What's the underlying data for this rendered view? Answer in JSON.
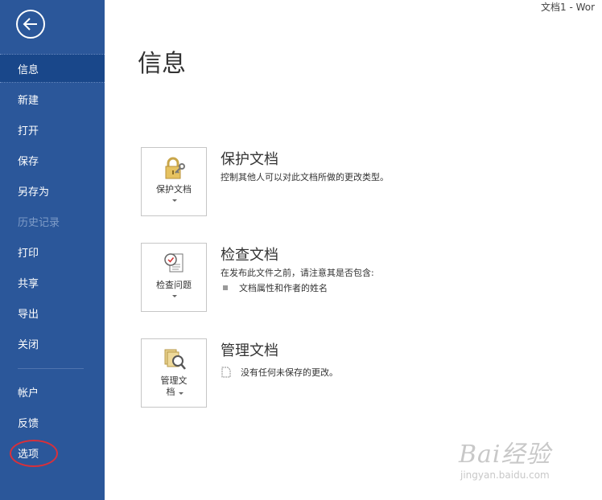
{
  "window": {
    "title": "文档1 - Wor"
  },
  "sidebar": {
    "items": [
      {
        "label": "信息",
        "state": "active"
      },
      {
        "label": "新建",
        "state": "normal"
      },
      {
        "label": "打开",
        "state": "normal"
      },
      {
        "label": "保存",
        "state": "normal"
      },
      {
        "label": "另存为",
        "state": "normal"
      },
      {
        "label": "历史记录",
        "state": "disabled"
      },
      {
        "label": "打印",
        "state": "normal"
      },
      {
        "label": "共享",
        "state": "normal"
      },
      {
        "label": "导出",
        "state": "normal"
      },
      {
        "label": "关闭",
        "state": "normal"
      },
      {
        "label": "帐户",
        "state": "normal"
      },
      {
        "label": "反馈",
        "state": "normal"
      },
      {
        "label": "选项",
        "state": "normal"
      }
    ]
  },
  "main": {
    "title": "信息",
    "sections": {
      "protect": {
        "button_label": "保护文档",
        "title": "保护文档",
        "description": "控制其他人可以对此文档所做的更改类型。"
      },
      "inspect": {
        "button_label": "检查问题",
        "title": "检查文档",
        "description": "在发布此文件之前，请注意其是否包含:",
        "bullets": [
          "文档属性和作者的姓名"
        ]
      },
      "manage": {
        "button_label_line1": "管理文",
        "button_label_line2": "档",
        "title": "管理文档",
        "note": "没有任何未保存的更改。"
      }
    }
  },
  "watermark": {
    "text": "Bai经验",
    "url_text": "jingyan.baidu.com"
  },
  "colors": {
    "sidebar_bg": "#2b579a",
    "active_bg": "#19478a",
    "highlight_circle": "#d9303a"
  }
}
